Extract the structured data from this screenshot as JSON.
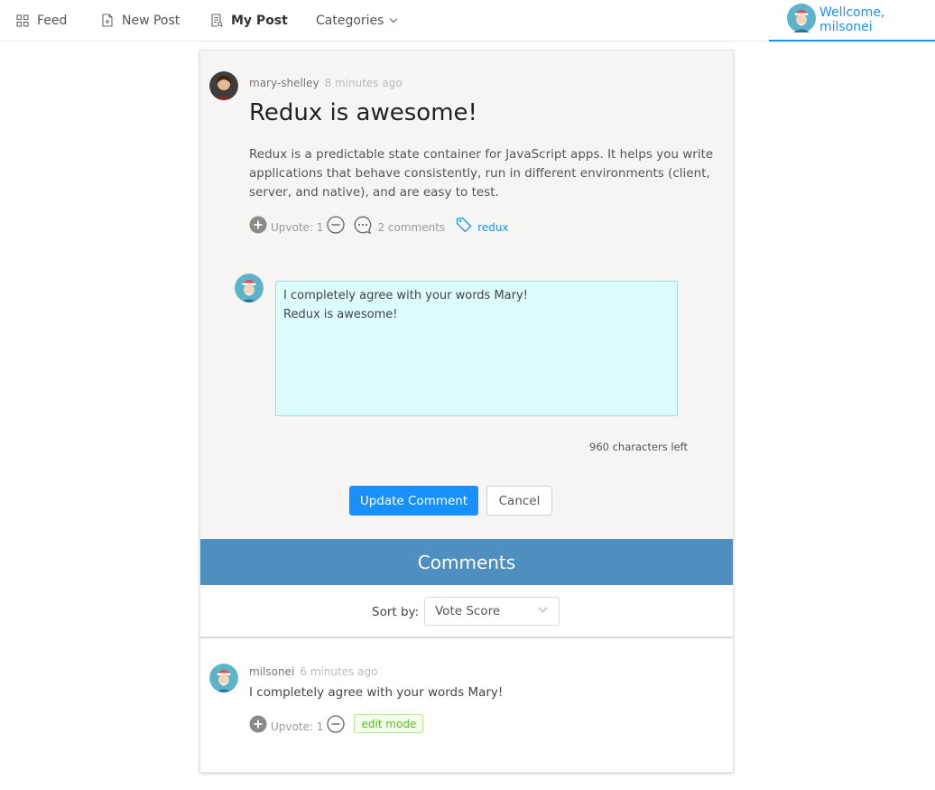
{
  "nav": {
    "feed": "Feed",
    "new_post": "New Post",
    "my_post": "My Post",
    "categories": "Categories",
    "welcome": "Wellcome, milsonei"
  },
  "post": {
    "author": "mary-shelley",
    "time_ago": "8 minutes ago",
    "title": "Redux is awesome!",
    "body": "Redux is a predictable state container for JavaScript apps. It helps you write applications that behave consistently, run in different environments (client, server, and native), and are easy to test.",
    "upvote_label": "Upvote: 1",
    "comments_label": "2 comments",
    "tag": "redux"
  },
  "comment_editor": {
    "value": "I completely agree with your words Mary!\nRedux is awesome!",
    "chars_left": "960 characters left",
    "update_label": "Update Comment",
    "cancel_label": "Cancel"
  },
  "comments": {
    "header": "Comments",
    "sort_label": "Sort by:",
    "sort_value": "Vote Score",
    "items": [
      {
        "author": "milsonei",
        "time_ago": "6 minutes ago",
        "text": "I completely agree with your words Mary!",
        "upvote_label": "Upvote: 1",
        "badge": "edit mode"
      }
    ]
  },
  "colors": {
    "accent": "#1890ff",
    "comments_header": "#4f8fc0",
    "textarea_bg": "#dcfcfc",
    "post_bg": "#f7f5f4"
  },
  "icons": [
    "feed-icon",
    "new-post-icon",
    "my-post-icon",
    "chevron-down-icon",
    "plus-circle-icon",
    "minus-circle-icon",
    "comment-icon",
    "tag-icon"
  ]
}
